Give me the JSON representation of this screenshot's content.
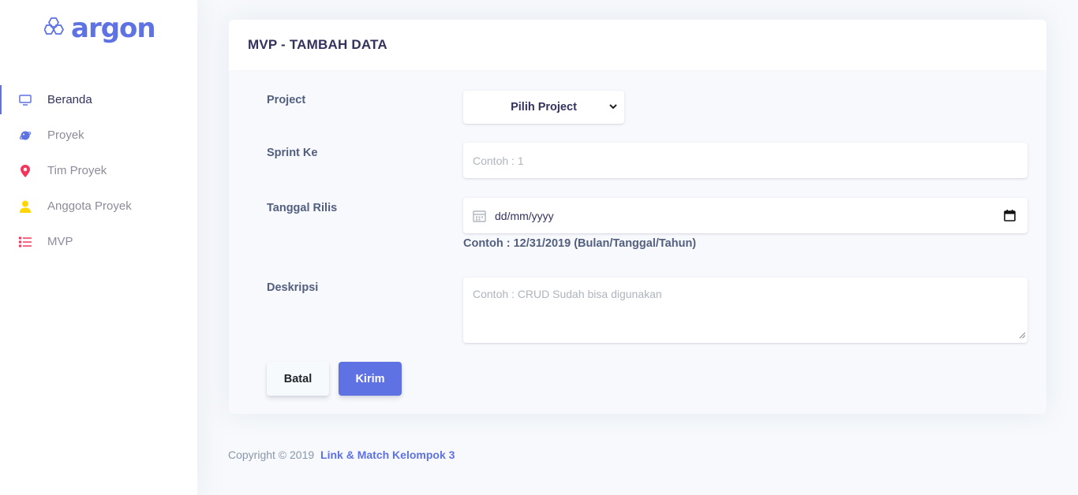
{
  "brand": {
    "name": "argon",
    "color": "#5e72e4",
    "icon": "hexagons-logo-icon"
  },
  "sidebar": {
    "items": [
      {
        "label": "Beranda",
        "icon": "tv-icon",
        "color": "#5e72e4",
        "active": true
      },
      {
        "label": "Proyek",
        "icon": "planet-icon",
        "color": "#5e72e4",
        "active": false
      },
      {
        "label": "Tim Proyek",
        "icon": "pin-icon",
        "color": "#f5365c",
        "active": false
      },
      {
        "label": "Anggota Proyek",
        "icon": "user-icon",
        "color": "#ffd600",
        "active": false
      },
      {
        "label": "MVP",
        "icon": "list-icon",
        "color": "#f5365c",
        "active": false
      }
    ]
  },
  "card": {
    "title": "MVP - TAMBAH DATA",
    "project": {
      "label": "Project",
      "selected": "Pilih Project"
    },
    "sprint": {
      "label": "Sprint Ke",
      "placeholder": "Contoh : 1"
    },
    "release": {
      "label": "Tanggal Rilis",
      "value": "dd/mm/yyyy",
      "hint": "Contoh : 12/31/2019 (Bulan/Tanggal/Tahun)"
    },
    "description": {
      "label": "Deskripsi",
      "placeholder": "Contoh : CRUD Sudah bisa digunakan"
    },
    "buttons": {
      "cancel": "Batal",
      "submit": "Kirim"
    }
  },
  "footer": {
    "copyright": "Copyright © 2019",
    "link": "Link & Match Kelompok 3"
  }
}
